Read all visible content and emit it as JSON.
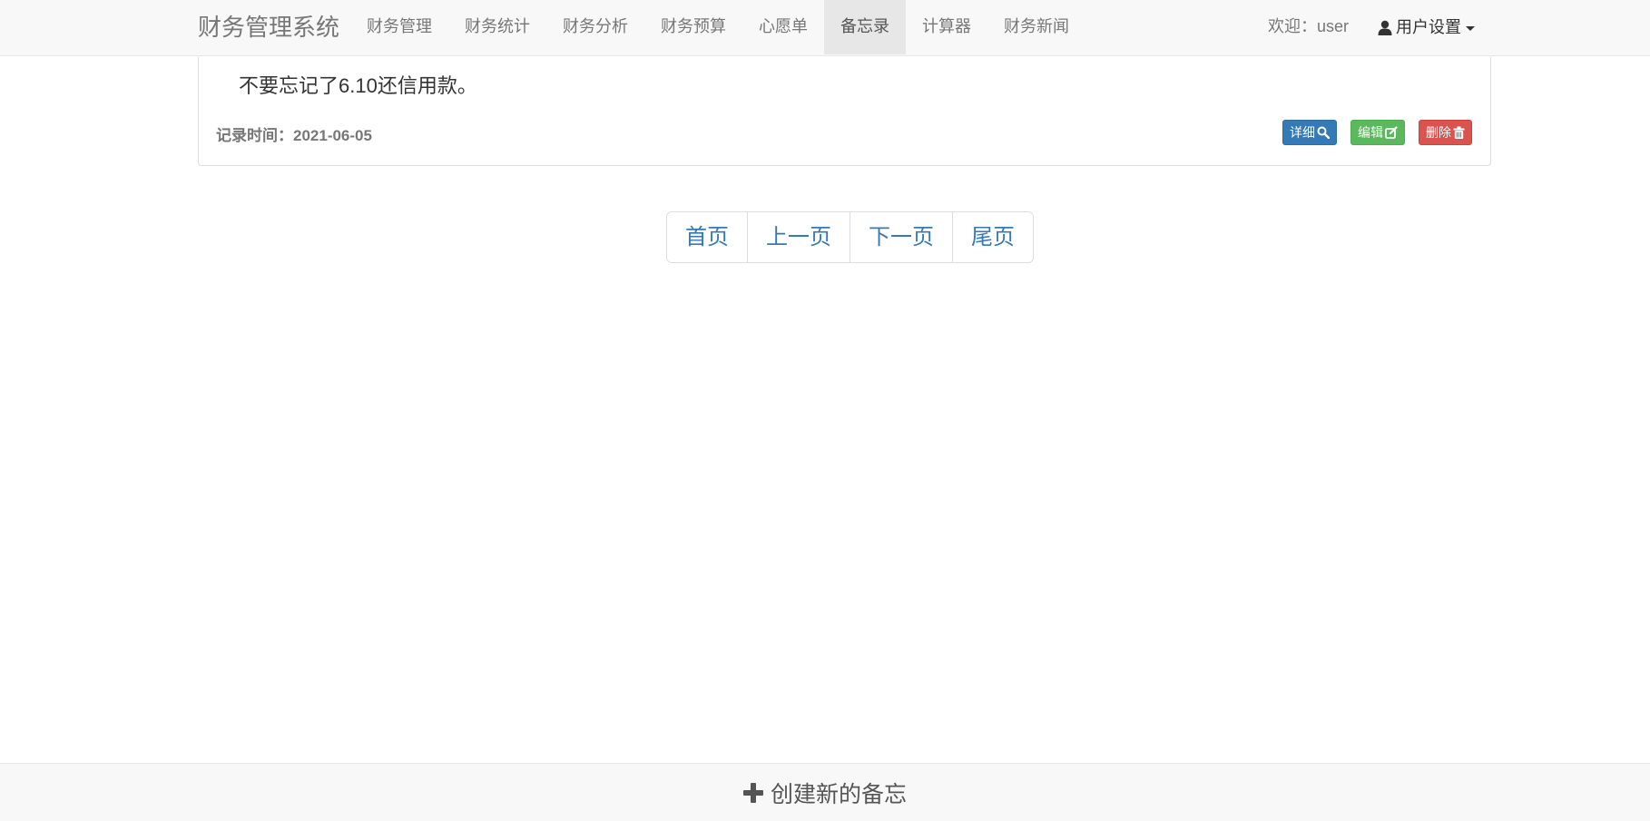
{
  "app": {
    "title": "财务管理系统"
  },
  "nav": {
    "items": [
      {
        "label": "财务管理"
      },
      {
        "label": "财务统计"
      },
      {
        "label": "财务分析"
      },
      {
        "label": "财务预算"
      },
      {
        "label": "心愿单"
      },
      {
        "label": "备忘录",
        "active": true
      },
      {
        "label": "计算器"
      },
      {
        "label": "财务新闻"
      }
    ],
    "welcome": "欢迎：user",
    "user_settings": "用户设置"
  },
  "memo": {
    "content": "不要忘记了6.10还信用款。",
    "time": "记录时间：2021-06-05",
    "buttons": {
      "detail": "详细",
      "edit": "编辑",
      "delete": "删除"
    }
  },
  "pagination": {
    "first": "首页",
    "prev": "上一页",
    "next": "下一页",
    "last": "尾页"
  },
  "footer": {
    "create_label": "创建新的备忘"
  },
  "colors": {
    "primary": "#337ab7",
    "success": "#5cb85c",
    "danger": "#d9534f",
    "navbar_bg": "#f8f8f8"
  },
  "icons": {
    "user": "user-icon",
    "detail": "search-icon",
    "edit": "edit-icon",
    "delete": "trash-icon",
    "create": "plus-icon"
  }
}
